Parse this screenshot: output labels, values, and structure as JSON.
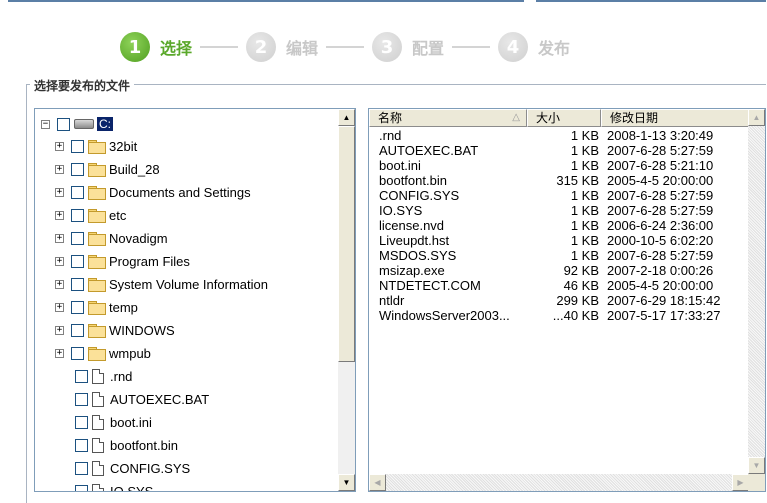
{
  "wizard": {
    "steps": [
      {
        "num": "1",
        "label": "选择",
        "active": true
      },
      {
        "num": "2",
        "label": "编辑",
        "active": false
      },
      {
        "num": "3",
        "label": "配置",
        "active": false
      },
      {
        "num": "4",
        "label": "发布",
        "active": false
      }
    ]
  },
  "group": {
    "title": "选择要发布的文件"
  },
  "tree": {
    "drive": {
      "label": "C:"
    },
    "folders": [
      "32bit",
      "Build_28",
      "Documents and Settings",
      "etc",
      "Novadigm",
      "Program Files",
      "System Volume Information",
      "temp",
      "WINDOWS",
      "wmpub"
    ],
    "files": [
      ".rnd",
      "AUTOEXEC.BAT",
      "boot.ini",
      "bootfont.bin",
      "CONFIG.SYS",
      "IO.SYS"
    ]
  },
  "list": {
    "columns": {
      "name": "名称",
      "size": "大小",
      "modified": "修改日期"
    },
    "rows": [
      {
        "name": ".rnd",
        "size": "1 KB",
        "modified": "2008-1-13 3:20:49"
      },
      {
        "name": "AUTOEXEC.BAT",
        "size": "1 KB",
        "modified": "2007-6-28 5:27:59"
      },
      {
        "name": "boot.ini",
        "size": "1 KB",
        "modified": "2007-6-28 5:21:10"
      },
      {
        "name": "bootfont.bin",
        "size": "315 KB",
        "modified": "2005-4-5 20:00:00"
      },
      {
        "name": "CONFIG.SYS",
        "size": "1 KB",
        "modified": "2007-6-28 5:27:59"
      },
      {
        "name": "IO.SYS",
        "size": "1 KB",
        "modified": "2007-6-28 5:27:59"
      },
      {
        "name": "license.nvd",
        "size": "1 KB",
        "modified": "2006-6-24 2:36:00"
      },
      {
        "name": "Liveupdt.hst",
        "size": "1 KB",
        "modified": "2000-10-5 6:02:20"
      },
      {
        "name": "MSDOS.SYS",
        "size": "1 KB",
        "modified": "2007-6-28 5:27:59"
      },
      {
        "name": "msizap.exe",
        "size": "92 KB",
        "modified": "2007-2-18 0:00:26"
      },
      {
        "name": "NTDETECT.COM",
        "size": "46 KB",
        "modified": "2005-4-5 20:00:00"
      },
      {
        "name": "ntldr",
        "size": "299 KB",
        "modified": "2007-6-29 18:15:42"
      },
      {
        "name": "WindowsServer2003...",
        "size": "...40 KB",
        "modified": "2007-5-17 17:33:27"
      }
    ]
  },
  "icons": {
    "expand": "plus-square-icon",
    "folder": "folder-icon",
    "file": "file-icon",
    "drive": "hard-drive-icon",
    "scroll_up": "arrow-up-icon",
    "scroll_down": "arrow-down-icon",
    "scroll_left": "arrow-left-icon",
    "scroll_right": "arrow-right-icon",
    "sort": "sort-indicator-icon"
  },
  "colors": {
    "active_step": "#5aa82a",
    "inactive_step": "#c8c8c8",
    "selection": "#0a246a",
    "panel_border": "#7f9db9"
  }
}
